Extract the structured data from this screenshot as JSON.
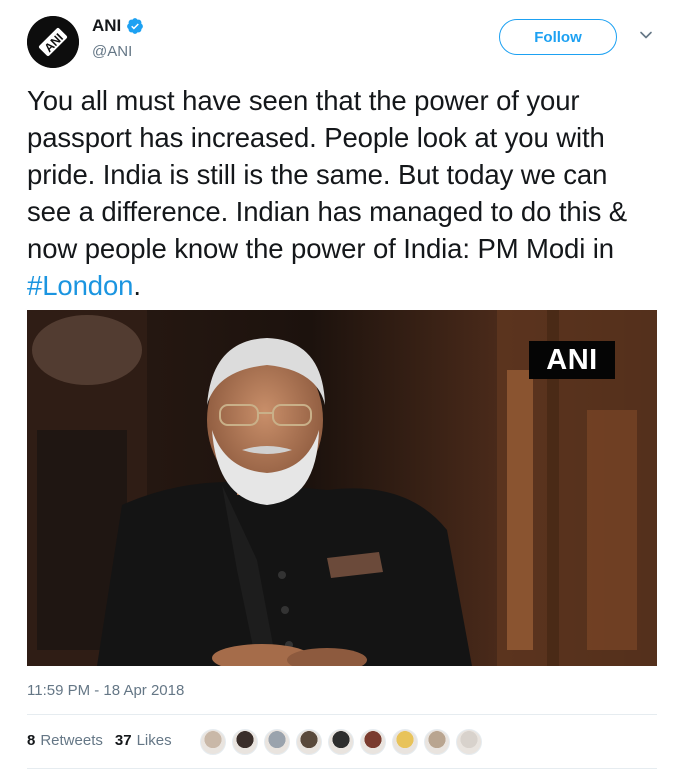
{
  "account": {
    "name": "ANI",
    "handle": "@ANI",
    "avatar_text": "ANI"
  },
  "follow_label": "Follow",
  "tweet": {
    "text": "You all must have seen that the power of your passport has increased. People look at you with pride. India is still is the same. But today we can see a difference. Indian has managed to do this & now people know the power of India: PM Modi in ",
    "hashtag": "#London",
    "trailing": "."
  },
  "media": {
    "watermark": "ANI"
  },
  "timestamp": "11:59 PM - 18 Apr 2018",
  "stats": {
    "retweets_count": "8",
    "retweets_label": "Retweets",
    "likes_count": "37",
    "likes_label": "Likes"
  },
  "likers": [
    {
      "color": "#c9b8a8"
    },
    {
      "color": "#3a2e2a"
    },
    {
      "color": "#9aa3ad"
    },
    {
      "color": "#5a4a3c"
    },
    {
      "color": "#2e2e2e"
    },
    {
      "color": "#7a3b2e"
    },
    {
      "color": "#e8c35a"
    },
    {
      "color": "#b9a590"
    },
    {
      "color": "#d8d2cc"
    }
  ],
  "colors": {
    "accent": "#1da1f2",
    "hashtag": "#1b95e0",
    "secondary_text": "#657786"
  }
}
